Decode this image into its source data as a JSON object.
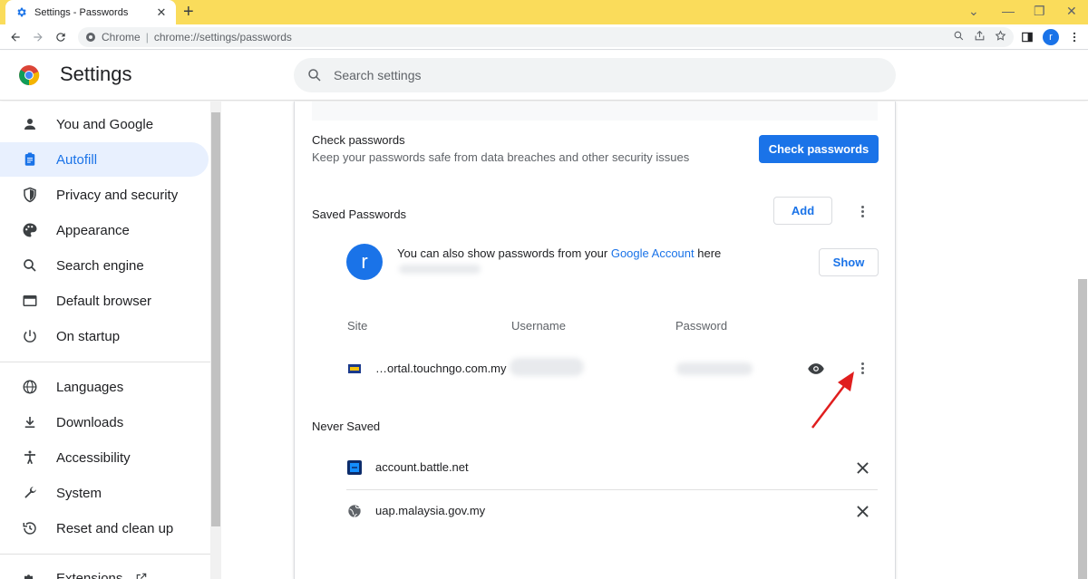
{
  "browser": {
    "tab_title": "Settings - Passwords",
    "omnibox_site": "Chrome",
    "omnibox_separator": "|",
    "omnibox_url": "chrome://settings/passwords",
    "profile_initial": "r"
  },
  "header": {
    "title": "Settings",
    "search_placeholder": "Search settings"
  },
  "sidebar": {
    "items": [
      {
        "label": "You and Google"
      },
      {
        "label": "Autofill"
      },
      {
        "label": "Privacy and security"
      },
      {
        "label": "Appearance"
      },
      {
        "label": "Search engine"
      },
      {
        "label": "Default browser"
      },
      {
        "label": "On startup"
      },
      {
        "label": "Languages"
      },
      {
        "label": "Downloads"
      },
      {
        "label": "Accessibility"
      },
      {
        "label": "System"
      },
      {
        "label": "Reset and clean up"
      },
      {
        "label": "Extensions"
      }
    ],
    "active_index": 1
  },
  "check_passwords": {
    "title": "Check passwords",
    "description": "Keep your passwords safe from data breaches and other security issues",
    "button": "Check passwords"
  },
  "saved_passwords": {
    "title": "Saved Passwords",
    "add_button": "Add",
    "account_prefix": "You can also show passwords from your",
    "account_link": "Google Account",
    "account_suffix": "here",
    "show_button": "Show",
    "account_initial": "r",
    "columns": [
      "Site",
      "Username",
      "Password"
    ],
    "rows": [
      {
        "site": "…ortal.touchngo.com.my"
      }
    ]
  },
  "never_saved": {
    "title": "Never Saved",
    "rows": [
      {
        "site": "account.battle.net"
      },
      {
        "site": "uap.malaysia.gov.my"
      }
    ]
  },
  "colors": {
    "accent": "#1a73e8",
    "titlebar": "#fadc5b",
    "annotation_arrow": "#e01e1e"
  }
}
